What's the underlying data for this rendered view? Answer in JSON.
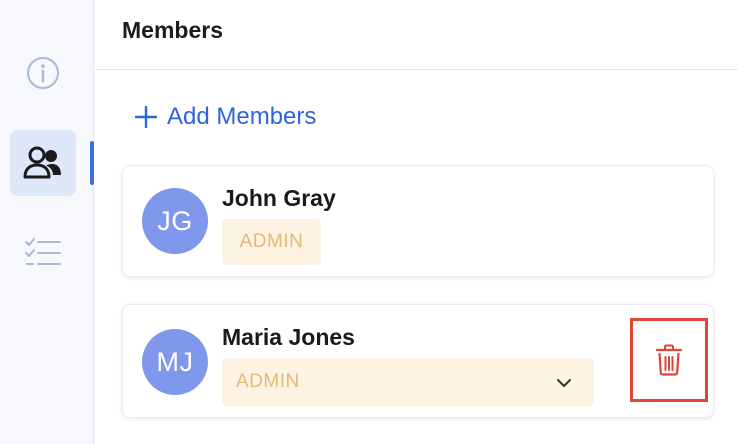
{
  "header": {
    "title": "Members"
  },
  "actions": {
    "add_members_label": "Add Members"
  },
  "members": [
    {
      "initials": "JG",
      "name": "John Gray",
      "role": "ADMIN",
      "editable": false
    },
    {
      "initials": "MJ",
      "name": "Maria Jones",
      "role": "ADMIN",
      "editable": true
    }
  ],
  "rail": {
    "items": [
      {
        "icon": "info-icon"
      },
      {
        "icon": "people-icon",
        "active": true
      },
      {
        "icon": "checklist-icon"
      }
    ]
  },
  "colors": {
    "accent": "#3f71dd",
    "avatar": "#8098ec",
    "role_text": "#e7b876",
    "role_bg": "#fcf3e3",
    "delete": "#e0453a"
  }
}
